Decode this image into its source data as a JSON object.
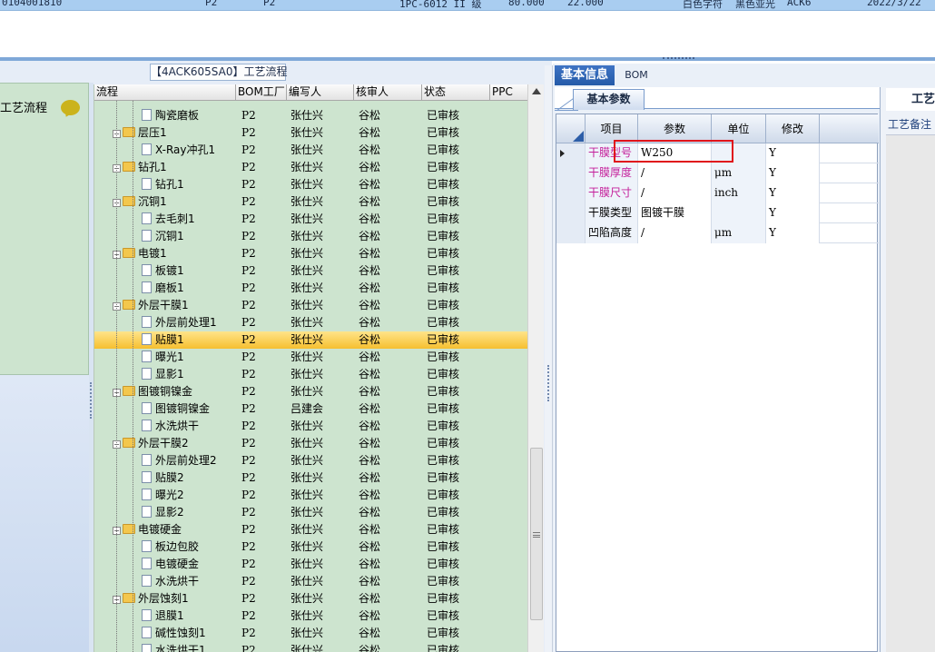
{
  "top_row": {
    "cells": [
      "0104001810",
      "P2",
      "P2",
      "1PC-6012 II 级",
      "80.000",
      "22.000",
      "白色字符",
      "黑色亚光",
      "ACK6",
      "2022/3/22"
    ]
  },
  "left_panel": {
    "title": "【4ACK605SA0】工艺流程",
    "side_label": "工艺流程",
    "columns": [
      "流程",
      "BOM工厂",
      "编写人",
      "核审人",
      "状态",
      "PPC"
    ],
    "rows": [
      {
        "name": "陶瓷磨板",
        "level": 2,
        "factory": "P2",
        "author": "张仕兴",
        "reviewer": "谷松",
        "status": "已审核"
      },
      {
        "name": "层压1",
        "level": 1,
        "factory": "P2",
        "author": "张仕兴",
        "reviewer": "谷松",
        "status": "已审核"
      },
      {
        "name": "X-Ray冲孔1",
        "level": 2,
        "factory": "P2",
        "author": "张仕兴",
        "reviewer": "谷松",
        "status": "已审核"
      },
      {
        "name": "钻孔1",
        "level": 1,
        "factory": "P2",
        "author": "张仕兴",
        "reviewer": "谷松",
        "status": "已审核"
      },
      {
        "name": "钻孔1",
        "level": 2,
        "factory": "P2",
        "author": "张仕兴",
        "reviewer": "谷松",
        "status": "已审核"
      },
      {
        "name": "沉铜1",
        "level": 1,
        "factory": "P2",
        "author": "张仕兴",
        "reviewer": "谷松",
        "status": "已审核"
      },
      {
        "name": "去毛刺1",
        "level": 2,
        "factory": "P2",
        "author": "张仕兴",
        "reviewer": "谷松",
        "status": "已审核"
      },
      {
        "name": "沉铜1",
        "level": 2,
        "factory": "P2",
        "author": "张仕兴",
        "reviewer": "谷松",
        "status": "已审核"
      },
      {
        "name": "电镀1",
        "level": 1,
        "factory": "P2",
        "author": "张仕兴",
        "reviewer": "谷松",
        "status": "已审核"
      },
      {
        "name": "板镀1",
        "level": 2,
        "factory": "P2",
        "author": "张仕兴",
        "reviewer": "谷松",
        "status": "已审核"
      },
      {
        "name": "磨板1",
        "level": 2,
        "factory": "P2",
        "author": "张仕兴",
        "reviewer": "谷松",
        "status": "已审核"
      },
      {
        "name": "外层干膜1",
        "level": 1,
        "factory": "P2",
        "author": "张仕兴",
        "reviewer": "谷松",
        "status": "已审核"
      },
      {
        "name": "外层前处理1",
        "level": 2,
        "factory": "P2",
        "author": "张仕兴",
        "reviewer": "谷松",
        "status": "已审核"
      },
      {
        "name": "贴膜1",
        "level": 2,
        "factory": "P2",
        "author": "张仕兴",
        "reviewer": "谷松",
        "status": "已审核",
        "selected": true
      },
      {
        "name": "曝光1",
        "level": 2,
        "factory": "P2",
        "author": "张仕兴",
        "reviewer": "谷松",
        "status": "已审核"
      },
      {
        "name": "显影1",
        "level": 2,
        "factory": "P2",
        "author": "张仕兴",
        "reviewer": "谷松",
        "status": "已审核"
      },
      {
        "name": "图镀铜镍金",
        "level": 1,
        "factory": "P2",
        "author": "张仕兴",
        "reviewer": "谷松",
        "status": "已审核"
      },
      {
        "name": "图镀铜镍金",
        "level": 2,
        "factory": "P2",
        "author": "吕建会",
        "reviewer": "谷松",
        "status": "已审核"
      },
      {
        "name": "水洗烘干",
        "level": 2,
        "factory": "P2",
        "author": "张仕兴",
        "reviewer": "谷松",
        "status": "已审核"
      },
      {
        "name": "外层干膜2",
        "level": 1,
        "factory": "P2",
        "author": "张仕兴",
        "reviewer": "谷松",
        "status": "已审核"
      },
      {
        "name": "外层前处理2",
        "level": 2,
        "factory": "P2",
        "author": "张仕兴",
        "reviewer": "谷松",
        "status": "已审核"
      },
      {
        "name": "贴膜2",
        "level": 2,
        "factory": "P2",
        "author": "张仕兴",
        "reviewer": "谷松",
        "status": "已审核"
      },
      {
        "name": "曝光2",
        "level": 2,
        "factory": "P2",
        "author": "张仕兴",
        "reviewer": "谷松",
        "status": "已审核"
      },
      {
        "name": "显影2",
        "level": 2,
        "factory": "P2",
        "author": "张仕兴",
        "reviewer": "谷松",
        "status": "已审核"
      },
      {
        "name": "电镀硬金",
        "level": 1,
        "factory": "P2",
        "author": "张仕兴",
        "reviewer": "谷松",
        "status": "已审核"
      },
      {
        "name": "板边包胶",
        "level": 2,
        "factory": "P2",
        "author": "张仕兴",
        "reviewer": "谷松",
        "status": "已审核"
      },
      {
        "name": "电镀硬金",
        "level": 2,
        "factory": "P2",
        "author": "张仕兴",
        "reviewer": "谷松",
        "status": "已审核"
      },
      {
        "name": "水洗烘干",
        "level": 2,
        "factory": "P2",
        "author": "张仕兴",
        "reviewer": "谷松",
        "status": "已审核"
      },
      {
        "name": "外层蚀刻1",
        "level": 1,
        "factory": "P2",
        "author": "张仕兴",
        "reviewer": "谷松",
        "status": "已审核"
      },
      {
        "name": "退膜1",
        "level": 2,
        "factory": "P2",
        "author": "张仕兴",
        "reviewer": "谷松",
        "status": "已审核"
      },
      {
        "name": "碱性蚀刻1",
        "level": 2,
        "factory": "P2",
        "author": "张仕兴",
        "reviewer": "谷松",
        "status": "已审核"
      },
      {
        "name": "水洗烘干1",
        "level": 2,
        "factory": "P2",
        "author": "张仕兴",
        "reviewer": "谷松",
        "status": "已审核"
      }
    ]
  },
  "right_panel": {
    "tabs": [
      "基本信息",
      "BOM"
    ],
    "subtab": "基本参数",
    "columns": [
      "项目",
      "参数",
      "单位",
      "修改"
    ],
    "rows": [
      {
        "item": "干膜型号",
        "param": "W250",
        "unit": "",
        "modify": "Y",
        "highlight": true,
        "current": true
      },
      {
        "item": "干膜厚度",
        "param": "/",
        "unit": "μm",
        "modify": "Y",
        "highlight": true
      },
      {
        "item": "干膜尺寸",
        "param": "/",
        "unit": "inch",
        "modify": "Y",
        "highlight": true
      },
      {
        "item": "干膜类型",
        "param": "图镀干膜",
        "unit": "",
        "modify": "Y",
        "highlight": false
      },
      {
        "item": "凹陷高度",
        "param": "/",
        "unit": "μm",
        "modify": "Y",
        "highlight": false
      }
    ],
    "side_tab": "工艺",
    "side_label": "工艺备注"
  },
  "colors": {
    "grid_green": "#cde4cf",
    "selected_row": "#f6bf30",
    "tab_blue": "#245aa8",
    "highlight_text": "#c4209b",
    "annotation_red": "#e0141b"
  }
}
